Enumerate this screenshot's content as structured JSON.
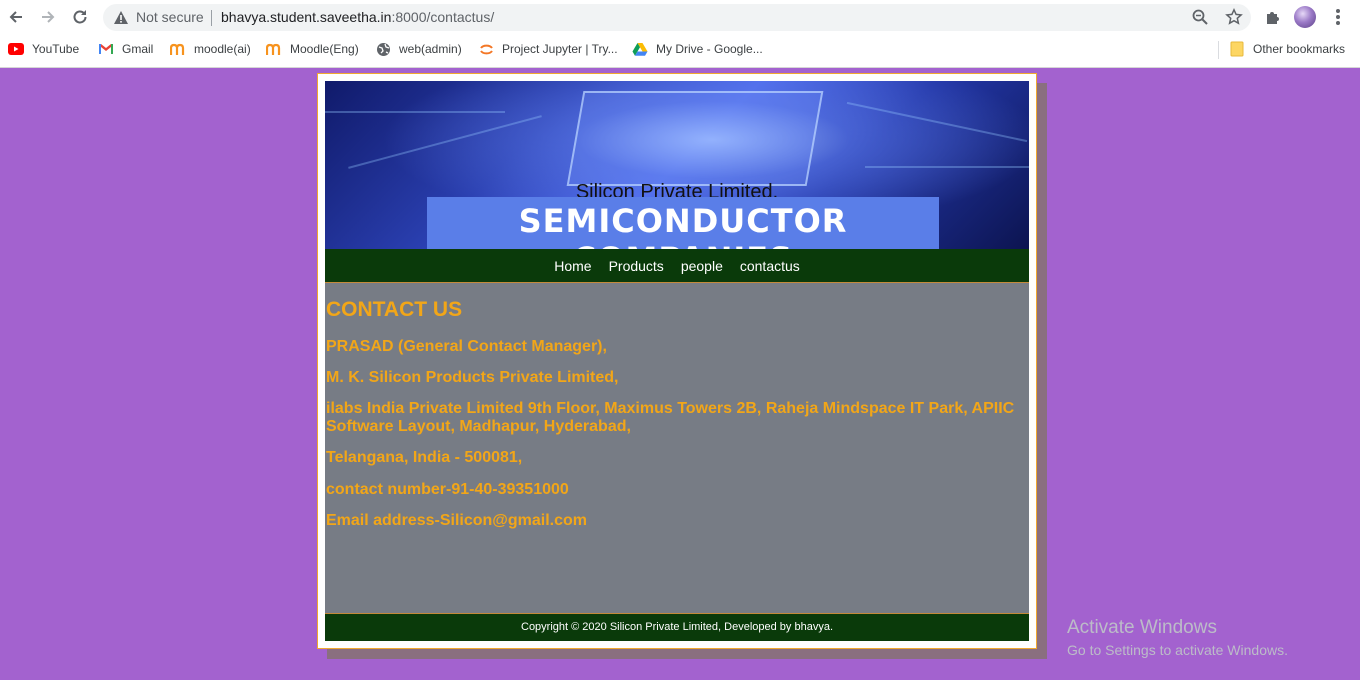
{
  "browser": {
    "not_secure": "Not secure",
    "url_host": "bhavya.student.saveetha.in",
    "url_rest": ":8000/contactus/",
    "bookmarks": [
      {
        "label": "YouTube",
        "icon": "youtube-icon"
      },
      {
        "label": "Gmail",
        "icon": "gmail-icon"
      },
      {
        "label": "moodle(ai)",
        "icon": "moodle-icon"
      },
      {
        "label": "Moodle(Eng)",
        "icon": "moodle-icon"
      },
      {
        "label": "web(admin)",
        "icon": "globe-icon"
      },
      {
        "label": "Project Jupyter | Try...",
        "icon": "jupyter-icon"
      },
      {
        "label": "My Drive - Google...",
        "icon": "google-drive-icon"
      }
    ],
    "other_bookmarks": "Other bookmarks"
  },
  "banner": {
    "title": "Silicon Private Limited.",
    "subtitle": "SEMICONDUCTOR COMPANIES"
  },
  "menu": {
    "items": [
      "Home",
      "Products",
      "people",
      "contactus"
    ]
  },
  "contact": {
    "heading": "CONTACT US",
    "lines": [
      "PRASAD (General Contact Manager),",
      "M. K. Silicon Products Private Limited,",
      "ilabs India Private Limited 9th Floor, Maximus Towers 2B, Raheja Mindspace IT Park, APIIC Software Layout, Madhapur, Hyderabad,",
      "Telangana, India - 500081,",
      "contact number-91-40-39351000",
      "Email address-Silicon@gmail.com"
    ]
  },
  "footer": {
    "text": "Copyright © 2020 Silicon Private Limited, Developed by bhavya."
  },
  "watermark": {
    "line1": "Activate Windows",
    "line2": "Go to Settings to activate Windows."
  },
  "colors": {
    "page_background": "#a362cf",
    "nav_green": "#0a3a0a",
    "content_gray": "#777c85",
    "accent_orange": "#f2a618"
  }
}
